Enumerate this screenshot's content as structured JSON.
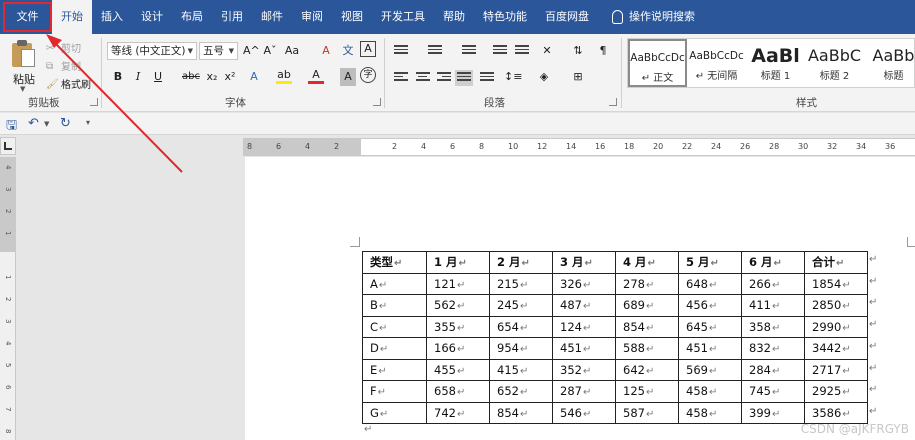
{
  "tabs": [
    {
      "label": "文件",
      "name": "tab-file"
    },
    {
      "label": "开始",
      "name": "tab-home"
    },
    {
      "label": "插入",
      "name": "tab-insert"
    },
    {
      "label": "设计",
      "name": "tab-design"
    },
    {
      "label": "布局",
      "name": "tab-layout"
    },
    {
      "label": "引用",
      "name": "tab-references"
    },
    {
      "label": "邮件",
      "name": "tab-mailings"
    },
    {
      "label": "审阅",
      "name": "tab-review"
    },
    {
      "label": "视图",
      "name": "tab-view"
    },
    {
      "label": "开发工具",
      "name": "tab-developer"
    },
    {
      "label": "帮助",
      "name": "tab-help"
    },
    {
      "label": "特色功能",
      "name": "tab-features"
    },
    {
      "label": "百度网盘",
      "name": "tab-baidu"
    }
  ],
  "tell_me": "操作说明搜索",
  "clipboard": {
    "paste": "粘贴",
    "cut": "剪切",
    "copy": "复制",
    "format_painter": "格式刷",
    "group": "剪贴板"
  },
  "font": {
    "family": "等线 (中文正文)",
    "size": "五号",
    "group": "字体",
    "bold": "B",
    "italic": "I",
    "underline": "U",
    "strike": "abc",
    "subscript": "x₂",
    "superscript": "x²",
    "grow": "A^",
    "shrink": "Aˇ",
    "case": "Aa",
    "clear": "A",
    "phonetic": "文",
    "border_char": "A"
  },
  "paragraph": {
    "group": "段落"
  },
  "styles": {
    "group": "样式",
    "items": [
      {
        "sample": "AaBbCcDc",
        "name": "↵ 正文"
      },
      {
        "sample": "AaBbCcDc",
        "name": "↵ 无间隔"
      },
      {
        "sample": "AaBl",
        "name": "标题 1"
      },
      {
        "sample": "AaBbC",
        "name": "标题 2"
      },
      {
        "sample": "AaBb",
        "name": "标题"
      }
    ]
  },
  "ruler": {
    "h_ticks": [
      "8",
      "6",
      "4",
      "2",
      "",
      "2",
      "4",
      "6",
      "8",
      "10",
      "12",
      "14",
      "16",
      "18",
      "20",
      "22",
      "24",
      "26",
      "28",
      "30",
      "32",
      "34",
      "36"
    ],
    "v_ticks": [
      "4",
      "3",
      "2",
      "1",
      "",
      "1",
      "2",
      "3",
      "4",
      "5",
      "6",
      "7",
      "8"
    ]
  },
  "table": {
    "header": [
      "类型",
      "1 月",
      "2 月",
      "3 月",
      "4 月",
      "5 月",
      "6 月",
      "合计"
    ],
    "rows": [
      [
        "A",
        "121",
        "215",
        "326",
        "278",
        "648",
        "266",
        "1854"
      ],
      [
        "B",
        "562",
        "245",
        "487",
        "689",
        "456",
        "411",
        "2850"
      ],
      [
        "C",
        "355",
        "654",
        "124",
        "854",
        "645",
        "358",
        "2990"
      ],
      [
        "D",
        "166",
        "954",
        "451",
        "588",
        "451",
        "832",
        "3442"
      ],
      [
        "E",
        "455",
        "415",
        "352",
        "642",
        "569",
        "284",
        "2717"
      ],
      [
        "F",
        "658",
        "652",
        "287",
        "125",
        "458",
        "745",
        "2925"
      ],
      [
        "G",
        "742",
        "854",
        "546",
        "587",
        "458",
        "399",
        "3586"
      ]
    ]
  },
  "colors": {
    "ribbon_blue": "#2b579a",
    "highlight_red": "#e0282e"
  },
  "watermark": "CSDN @aJKFRGYB"
}
